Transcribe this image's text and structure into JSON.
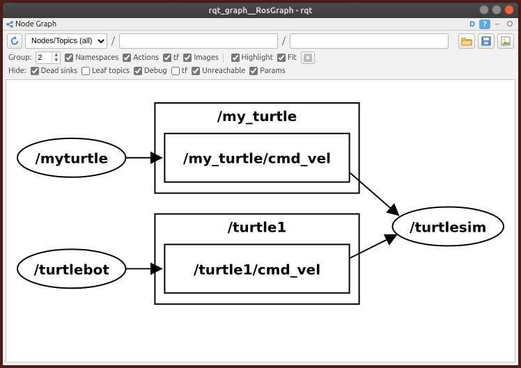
{
  "window": {
    "title": "rqt_graph__RosGraph - rqt"
  },
  "panel": {
    "title": "Node Graph"
  },
  "header_buttons": {
    "d": "D",
    "help": "?",
    "undock": "–",
    "close": "O"
  },
  "toolbar": {
    "filter_mode": "Nodes/Topics (all)",
    "slash1": "/",
    "input1": "",
    "slash2": "/",
    "input2": ""
  },
  "options_row1": {
    "group_label": "Group:",
    "group_value": "2",
    "namespaces_label": "Namespaces",
    "actions_label": "Actions",
    "tf_label": "tf",
    "images_label": "Images",
    "highlight_label": "Highlight",
    "fit_label": "Fit"
  },
  "options_row1_checked": {
    "namespaces": true,
    "actions": true,
    "tf": true,
    "images": true,
    "highlight": true,
    "fit": true
  },
  "options_row2": {
    "hide_label": "Hide:",
    "dead_sinks_label": "Dead sinks",
    "leaf_topics_label": "Leaf topics",
    "debug_label": "Debug",
    "tf_label": "tf",
    "unreachable_label": "Unreachable",
    "params_label": "Params"
  },
  "options_row2_checked": {
    "dead_sinks": true,
    "leaf_topics": false,
    "debug": true,
    "tf": false,
    "unreachable": true,
    "params": true
  },
  "graph": {
    "nodes": {
      "myturtle": "/myturtle",
      "turtlebot": "/turtlebot",
      "turtlesim": "/turtlesim"
    },
    "namespaces": {
      "my_turtle": "/my_turtle",
      "turtle1": "/turtle1"
    },
    "topics": {
      "my_turtle_cmd_vel": "/my_turtle/cmd_vel",
      "turtle1_cmd_vel": "/turtle1/cmd_vel"
    },
    "edges": [
      {
        "from": "myturtle",
        "to": "my_turtle_cmd_vel"
      },
      {
        "from": "turtlebot",
        "to": "turtle1_cmd_vel"
      },
      {
        "from": "my_turtle_cmd_vel",
        "to": "turtlesim"
      },
      {
        "from": "turtle1_cmd_vel",
        "to": "turtlesim"
      }
    ]
  }
}
